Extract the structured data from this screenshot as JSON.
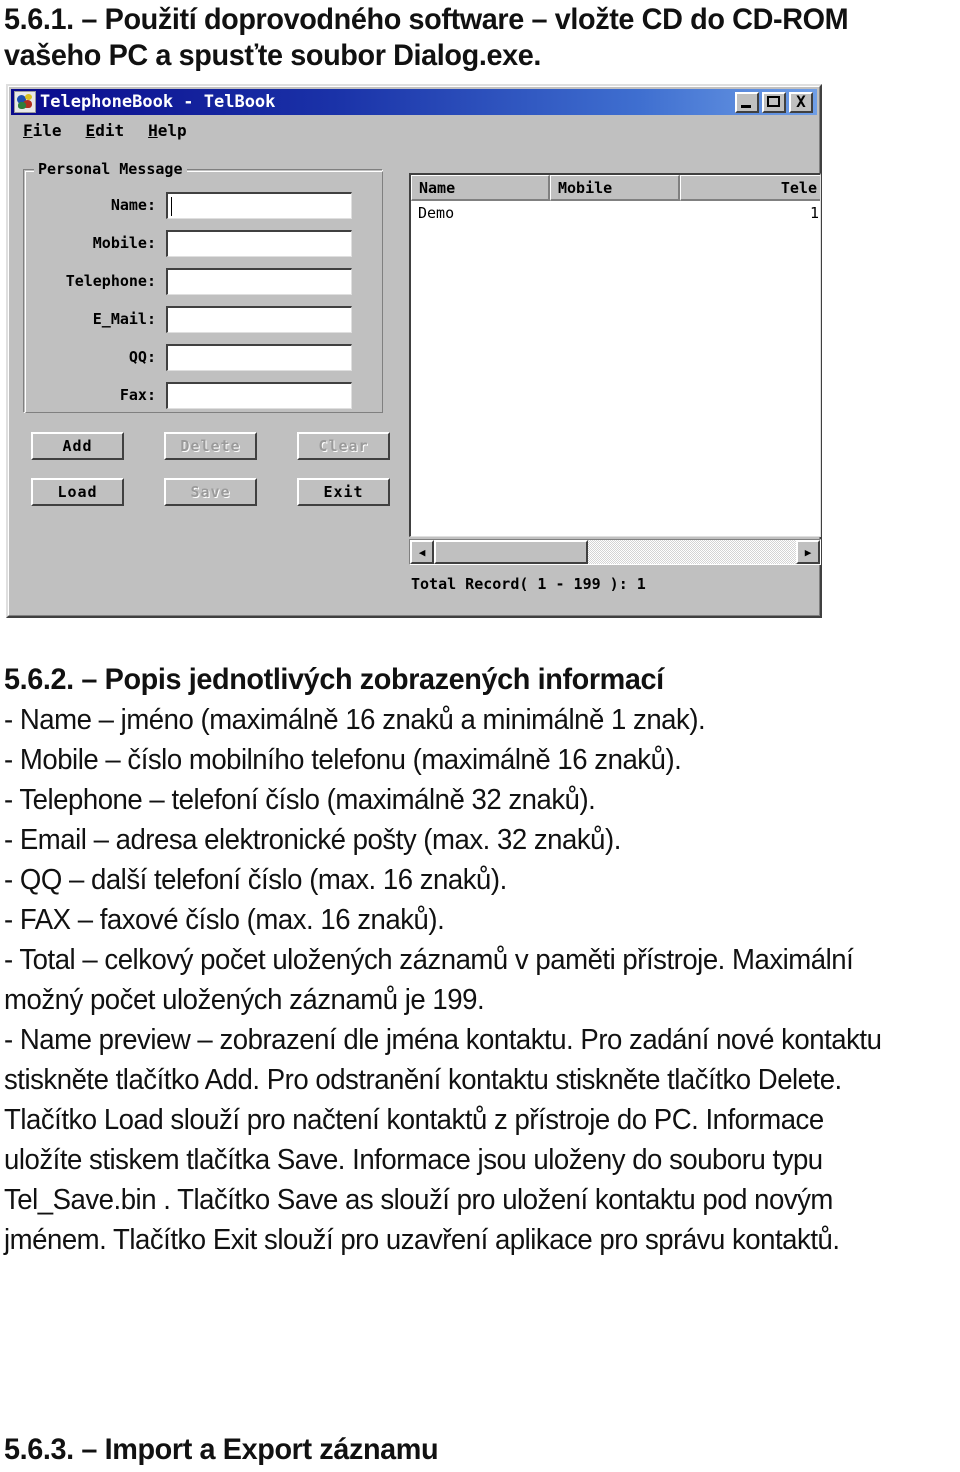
{
  "document": {
    "heading_1": "5.6.1. – Použití doprovodného software – vložte CD do CD-ROM vašeho PC a spusťte soubor Dialog.exe.",
    "heading_2": "5.6.2. – Popis jednotlivých zobrazených informací",
    "heading_3": "5.6.3. – Import a Export záznamu",
    "body_lines": [
      "- Name – jméno (maximálně 16 znaků a minimálně 1 znak).",
      "- Mobile – číslo mobilního telefonu (maximálně 16 znaků).",
      "- Telephone – telefoní číslo (maximálně 32 znaků).",
      "- Email – adresa elektronické pošty (max. 32 znaků).",
      "- QQ – další telefoní číslo (max. 16 znaků).",
      "- FAX – faxové číslo (max. 16 znaků).",
      "- Total – celkový počet uložených záznamů v paměti přístroje. Maximální možný počet uložených záznamů je 199.",
      "- Name preview – zobrazení dle jména kontaktu. Pro zadání nové kontaktu stiskněte tlačítko Add. Pro odstranění kontaktu stiskněte tlačítko Delete. Tlačítko Load slouží pro načtení kontaktů z přístroje do PC. Informace uložíte stiskem tlačítka Save. Informace jsou uloženy do souboru typu Tel_Save.bin . Tlačítko Save as slouží pro uložení kontaktu pod novým jménem. Tlačítko Exit slouží pro uzavření aplikace pro správu kontaktů."
    ]
  },
  "app_window": {
    "title": "TelephoneBook - TelBook",
    "title_colors": {
      "gradient_start": "#0a0a8c",
      "gradient_end": "#6f9ee6",
      "face": "#c0c0c0"
    },
    "window_buttons": [
      {
        "name": "minimize",
        "glyph": "_"
      },
      {
        "name": "maximize",
        "glyph": "□"
      },
      {
        "name": "close",
        "glyph": "X"
      }
    ],
    "menu": [
      {
        "label": "File",
        "mnemonic": "F",
        "rest": "ile"
      },
      {
        "label": "Edit",
        "mnemonic": "E",
        "rest": "dit"
      },
      {
        "label": "Help",
        "mnemonic": "H",
        "rest": "elp"
      }
    ],
    "groupbox": {
      "label": "Personal Message",
      "fields": [
        {
          "label": "Name:",
          "value": "",
          "focused": true
        },
        {
          "label": "Mobile:",
          "value": "",
          "focused": false
        },
        {
          "label": "Telephone:",
          "value": "",
          "focused": false
        },
        {
          "label": "E_Mail:",
          "value": "",
          "focused": false
        },
        {
          "label": "QQ:",
          "value": "",
          "focused": false
        },
        {
          "label": "Fax:",
          "value": "",
          "focused": false
        }
      ]
    },
    "buttons": [
      {
        "label": "Add",
        "enabled": true
      },
      {
        "label": "Delete",
        "enabled": false
      },
      {
        "label": "Clear",
        "enabled": false
      },
      {
        "label": "Load",
        "enabled": true
      },
      {
        "label": "Save",
        "enabled": false
      },
      {
        "label": "Exit",
        "enabled": true
      }
    ],
    "listview": {
      "columns": [
        "Name",
        "Mobile",
        "Tele"
      ],
      "rows": [
        {
          "name": "Demo",
          "mobile": "",
          "tele": "1"
        }
      ]
    },
    "scrollbar": {
      "left_arrow": "◀",
      "right_arrow": "▶"
    },
    "status": "Total Record( 1 - 199 ):   1"
  }
}
